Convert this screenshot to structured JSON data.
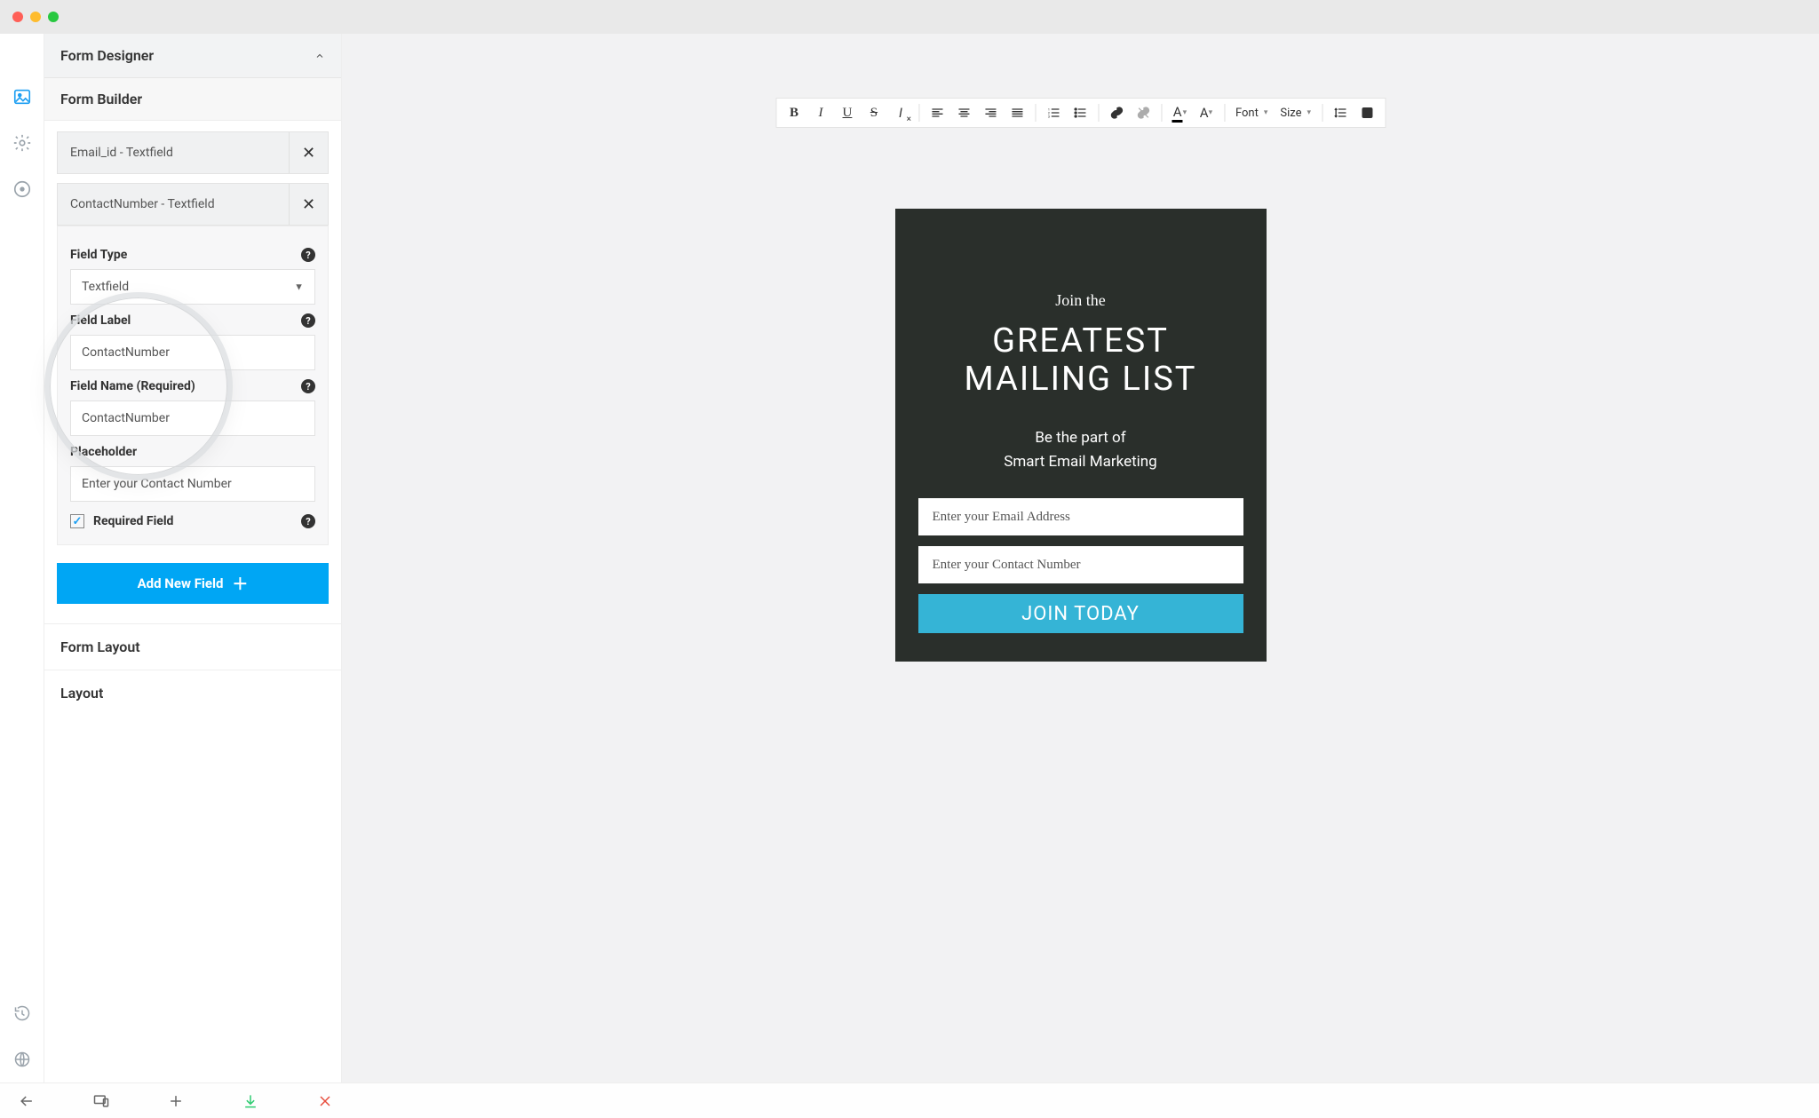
{
  "sidebar": {
    "title": "Form Designer",
    "sub_builder": "Form Builder",
    "field1": "Email_id - Textfield",
    "field2": "ContactNumber - Textfield",
    "editor": {
      "fieldTypeLabel": "Field Type",
      "fieldTypeValue": "Textfield",
      "fieldLabelLabel": "Field Label",
      "fieldLabelValue": "ContactNumber",
      "fieldNameLabel": "Field Name (Required)",
      "fieldNameValue": "ContactNumber",
      "placeholderLabel": "Placeholder",
      "placeholderValue": "Enter your Contact Number",
      "requiredLabel": "Required Field"
    },
    "addBtn": "Add New Field",
    "formLayout": "Form Layout",
    "layout": "Layout"
  },
  "toolbar": {
    "font": "Font",
    "size": "Size"
  },
  "preview": {
    "join": "Join the",
    "titleLine1": "GREATEST",
    "titleLine2": "MAILING LIST",
    "subLine1": "Be the part of",
    "subLine2": "Smart Email Marketing",
    "emailPh": "Enter your Email Address",
    "contactPh": "Enter your Contact Number",
    "cta": "JOIN TODAY"
  }
}
